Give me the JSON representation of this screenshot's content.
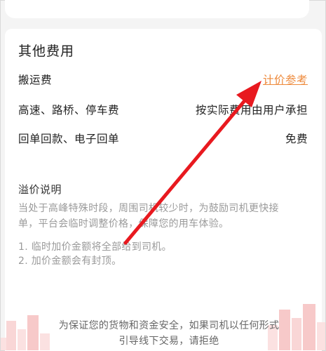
{
  "section_title": "其他费用",
  "fees": [
    {
      "label": "搬运费",
      "value": "计价参考"
    },
    {
      "label": "高速、路桥、停车费",
      "value": "按实际费用由用户承担"
    },
    {
      "label": "回单回款、电子回单",
      "value": "免费"
    }
  ],
  "surcharge": {
    "title": "溢价说明",
    "intro_line1": "当处于高峰特殊时段，周围司机较少时，为鼓励司机更快接",
    "intro_line2": "单，平台会临时调整价格，保障您的用车体验。",
    "item1": "1. 临时加价金额将全部给到司机。",
    "item2": "2. 加价金额会有封顶。"
  },
  "notice_line1": "为保证您的货物和资金安全，如果司机以任何形式",
  "notice_line2": "引导线下交易，请拒绝",
  "colors": {
    "link": "#ee8a3c",
    "arrow": "#e8191f",
    "deco": "#f7c9c9"
  }
}
